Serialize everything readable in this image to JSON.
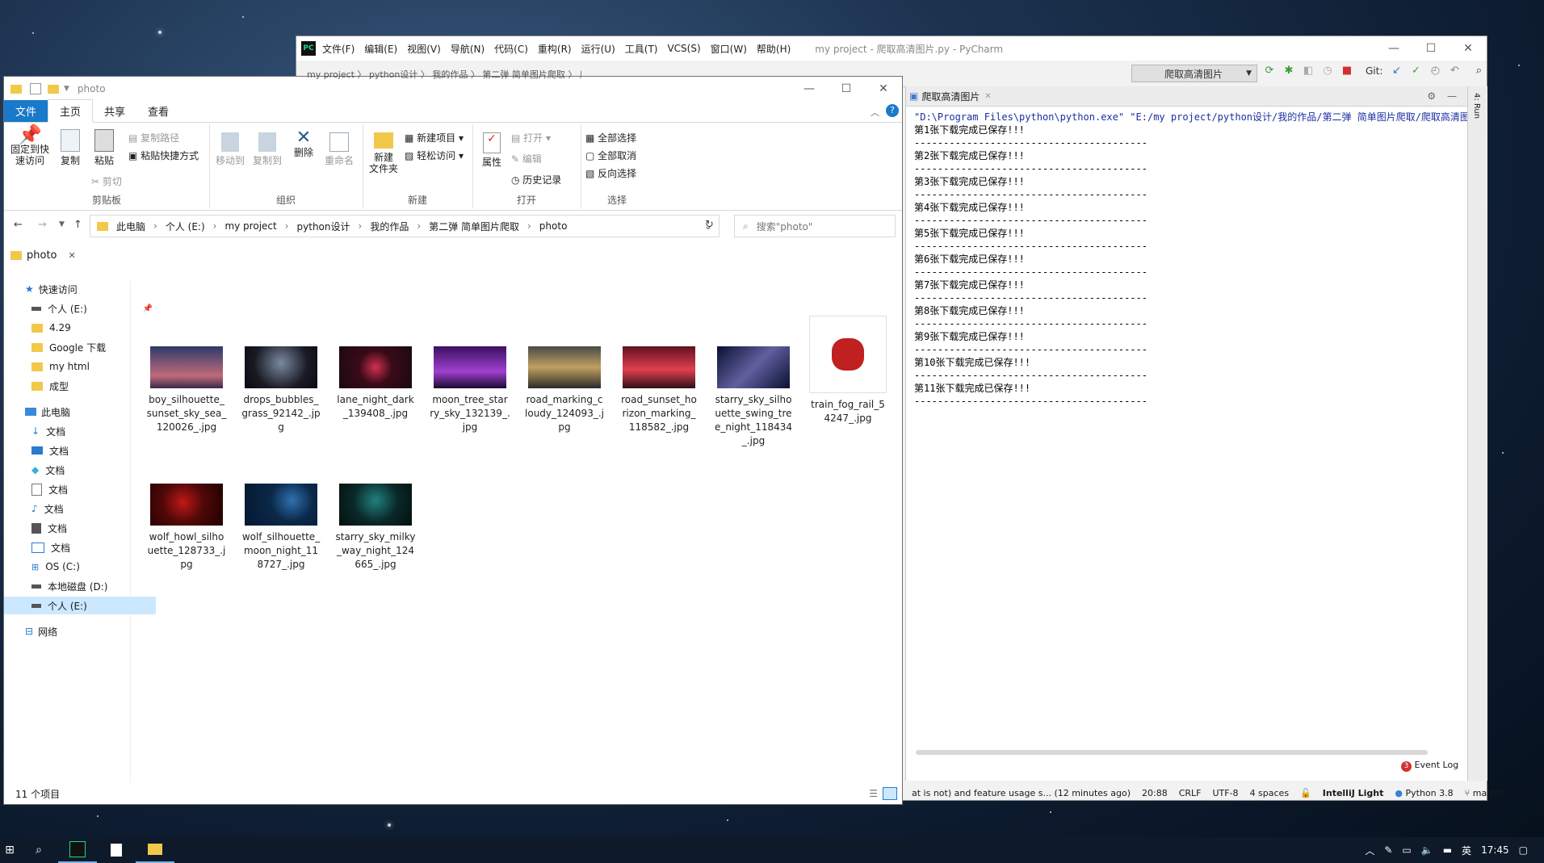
{
  "pycharm": {
    "logo": "PC",
    "menus": [
      "文件(F)",
      "编辑(E)",
      "视图(V)",
      "导航(N)",
      "代码(C)",
      "重构(R)",
      "运行(U)",
      "工具(T)",
      "VCS(S)",
      "窗口(W)",
      "帮助(H)"
    ],
    "title": "my project - 爬取高清图片.py - PyCharm",
    "breadcrumb": "my project 〉 python设计 〉 我的作品 〉 第二弹 简单图片爬取 〉 爬取高清图片.py 〉",
    "run_config": "爬取高清图片",
    "git_label": "Git:",
    "run_tab": "爬取高清图片",
    "run_side_label": "4: Run",
    "command": "\"D:\\Program Files\\python\\python.exe\" \"E:/my project/python设计/我的作品/第二弹 简单图片爬取/爬取高清图片",
    "console_lines": [
      "第1张下载完成已保存!!!",
      "第2张下载完成已保存!!!",
      "第3张下载完成已保存!!!",
      "第4张下载完成已保存!!!",
      "第5张下载完成已保存!!!",
      "第6张下载完成已保存!!!",
      "第7张下载完成已保存!!!",
      "第8张下载完成已保存!!!",
      "第9张下载完成已保存!!!",
      "第10张下载完成已保存!!!",
      "第11张下载完成已保存!!!"
    ],
    "separator": "----------------------------------------",
    "event_log_count": "3",
    "event_log": "Event Log",
    "status": {
      "message": "at is not) and feature usage s... (12 minutes ago)",
      "position": "20:88",
      "line_sep": "CRLF",
      "encoding": "UTF-8",
      "indent": "4 spaces",
      "theme": "IntelliJ Light",
      "interpreter": "Python 3.8",
      "branch": "master"
    }
  },
  "explorer": {
    "title": "photo",
    "tabs": [
      "文件",
      "主页",
      "共享",
      "查看"
    ],
    "ribbon": {
      "pin_label": "固定到快\n速访问",
      "copy_label": "复制",
      "paste_label": "粘贴",
      "copy_path": "复制路径",
      "paste_shortcut": "粘贴快捷方式",
      "cut": "剪切",
      "clipboard_group": "剪贴板",
      "move_to": "移动到",
      "copy_to": "复制到",
      "delete": "删除",
      "rename": "重命名",
      "organize_group": "组织",
      "new_folder": "新建\n文件夹",
      "new_item": "新建项目",
      "easy_access": "轻松访问",
      "new_group": "新建",
      "properties": "属性",
      "open": "打开",
      "edit": "编辑",
      "history": "历史记录",
      "open_group": "打开",
      "select_all": "全部选择",
      "select_none": "全部取消",
      "invert_selection": "反向选择",
      "select_group": "选择"
    },
    "address": [
      "此电脑",
      "个人 (E:)",
      "my project",
      "python设计",
      "我的作品",
      "第二弹 简单图片爬取",
      "photo"
    ],
    "search_placeholder": "搜索\"photo\"",
    "folder_tab": "photo",
    "nav": [
      {
        "label": "快速访问",
        "icon": "star-icon"
      },
      {
        "label": "个人 (E:)",
        "icon": "drive-icon"
      },
      {
        "label": "4.29",
        "icon": "folder-icon"
      },
      {
        "label": "Google 下载",
        "icon": "folder-icon"
      },
      {
        "label": "my html",
        "icon": "folder-icon"
      },
      {
        "label": "成型",
        "icon": "folder-icon"
      },
      {
        "label": "此电脑",
        "icon": "pc-icon"
      },
      {
        "label": "文档",
        "icon": "download-icon"
      },
      {
        "label": "文档",
        "icon": "desktop-icon"
      },
      {
        "label": "文档",
        "icon": "3d-icon"
      },
      {
        "label": "文档",
        "icon": "document-icon"
      },
      {
        "label": "文档",
        "icon": "music-icon"
      },
      {
        "label": "文档",
        "icon": "video-icon"
      },
      {
        "label": "文档",
        "icon": "picture-icon"
      },
      {
        "label": "OS (C:)",
        "icon": "windows-drive-icon"
      },
      {
        "label": "本地磁盘 (D:)",
        "icon": "drive-icon"
      },
      {
        "label": "个人 (E:)",
        "icon": "drive-icon"
      },
      {
        "label": "网络",
        "icon": "network-icon"
      }
    ],
    "files": [
      {
        "name": "boy_silhouette_\nsunset_sky_sea_\n120026_.jpg",
        "colors": [
          "#2c3a6a",
          "#c06a7a"
        ]
      },
      {
        "name": "drops_bubbles_\ngrass_92142_.jp\ng",
        "colors": [
          "#0a0a14",
          "#7a8aa0"
        ]
      },
      {
        "name": "lane_night_dark\n_139408_.jpg",
        "colors": [
          "#1a0a10",
          "#d03050"
        ]
      },
      {
        "name": "moon_tree_star\nry_sky_132139_.\njpg",
        "colors": [
          "#3a1060",
          "#a040d0"
        ]
      },
      {
        "name": "road_marking_c\nloudy_124093_.j\npg",
        "colors": [
          "#2a2a2a",
          "#c0a060"
        ]
      },
      {
        "name": "road_sunset_ho\nrizon_marking_\n118582_.jpg",
        "colors": [
          "#601020",
          "#e04050"
        ]
      },
      {
        "name": "starry_sky_silho\nuette_swing_tre\ne_night_118434\n_.jpg",
        "colors": [
          "#0a1030",
          "#6060a0"
        ]
      },
      {
        "name": "train_fog_rail_5\n4247_.jpg",
        "colors": [
          "#ffffff",
          "#c02020"
        ]
      },
      {
        "name": "wolf_howl_silho\nuette_128733_.j\npg",
        "colors": [
          "#200000",
          "#c01818"
        ]
      },
      {
        "name": "wolf_silhouette_\nmoon_night_11\n8727_.jpg",
        "colors": [
          "#051830",
          "#3070b0"
        ]
      },
      {
        "name": "starry_sky_milky\n_way_night_124\n665_.jpg",
        "colors": [
          "#051010",
          "#208080"
        ]
      }
    ],
    "item_count": "11 个项目"
  },
  "taskbar": {
    "time": "17:45",
    "ime": "英"
  }
}
